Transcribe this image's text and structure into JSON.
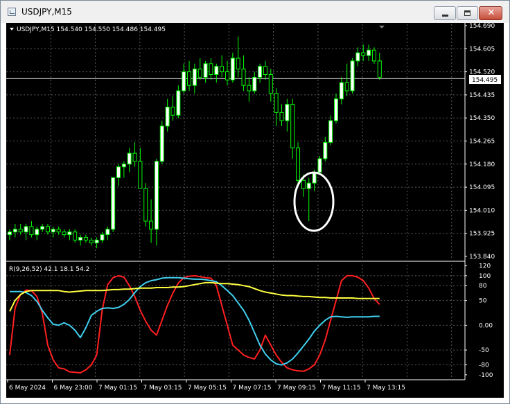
{
  "window": {
    "title": "USDJPY,M15",
    "minimize_label": "",
    "maximize_label": "",
    "close_label": "✕"
  },
  "header": {
    "symbol_info": "USDJPY,M15  154.540 154.550 154.486 154.495"
  },
  "price_axis": {
    "ticks": [
      "154.690",
      "154.605",
      "154.520",
      "154.435",
      "154.350",
      "154.265",
      "154.180",
      "154.095",
      "154.010",
      "153.925",
      "153.840"
    ],
    "current_price": "154.495"
  },
  "indicator": {
    "label": "R(9,26,52) 42.1 18.1 54.2",
    "ticks": [
      "120",
      "100",
      "80",
      "50",
      "0.00",
      "-50",
      "-80",
      "-100"
    ]
  },
  "time_axis": {
    "ticks": [
      "6 May 2024",
      "6 May 23:00",
      "7 May 01:15",
      "7 May 03:15",
      "7 May 05:15",
      "7 May 07:15",
      "7 May 09:15",
      "7 May 11:15",
      "7 May 13:15"
    ]
  },
  "colors": {
    "background": "#000000",
    "grid": "#5a5a5a",
    "candle": "#00ff00",
    "candle_fill": "#ffffff",
    "fast_line": "#ff2020",
    "mid_line": "#40d0f0",
    "slow_line": "#ffff40",
    "annotation": "#ffffff"
  },
  "chart_data": [
    {
      "type": "candlestick",
      "title": "USDJPY,M15",
      "ylim": [
        153.84,
        154.69
      ],
      "candles": [
        {
          "o": 153.92,
          "h": 153.94,
          "l": 153.9,
          "c": 153.93
        },
        {
          "o": 153.93,
          "h": 153.96,
          "l": 153.91,
          "c": 153.94
        },
        {
          "o": 153.94,
          "h": 153.96,
          "l": 153.92,
          "c": 153.93
        },
        {
          "o": 153.93,
          "h": 153.96,
          "l": 153.9,
          "c": 153.95
        },
        {
          "o": 153.95,
          "h": 153.97,
          "l": 153.91,
          "c": 153.92
        },
        {
          "o": 153.92,
          "h": 153.95,
          "l": 153.9,
          "c": 153.94
        },
        {
          "o": 153.94,
          "h": 153.96,
          "l": 153.93,
          "c": 153.95
        },
        {
          "o": 153.95,
          "h": 153.96,
          "l": 153.92,
          "c": 153.93
        },
        {
          "o": 153.93,
          "h": 153.95,
          "l": 153.91,
          "c": 153.94
        },
        {
          "o": 153.94,
          "h": 153.95,
          "l": 153.92,
          "c": 153.93
        },
        {
          "o": 153.93,
          "h": 153.94,
          "l": 153.91,
          "c": 153.92
        },
        {
          "o": 153.92,
          "h": 153.94,
          "l": 153.9,
          "c": 153.93
        },
        {
          "o": 153.93,
          "h": 153.94,
          "l": 153.89,
          "c": 153.9
        },
        {
          "o": 153.9,
          "h": 153.92,
          "l": 153.88,
          "c": 153.91
        },
        {
          "o": 153.91,
          "h": 153.92,
          "l": 153.89,
          "c": 153.9
        },
        {
          "o": 153.9,
          "h": 153.91,
          "l": 153.88,
          "c": 153.89
        },
        {
          "o": 153.89,
          "h": 153.91,
          "l": 153.87,
          "c": 153.9
        },
        {
          "o": 153.9,
          "h": 153.93,
          "l": 153.89,
          "c": 153.92
        },
        {
          "o": 153.92,
          "h": 153.95,
          "l": 153.9,
          "c": 153.94
        },
        {
          "o": 153.94,
          "h": 154.1,
          "l": 153.93,
          "c": 154.13
        },
        {
          "o": 154.13,
          "h": 154.18,
          "l": 154.1,
          "c": 154.17
        },
        {
          "o": 154.17,
          "h": 154.19,
          "l": 154.13,
          "c": 154.18
        },
        {
          "o": 154.18,
          "h": 154.24,
          "l": 154.15,
          "c": 154.22
        },
        {
          "o": 154.22,
          "h": 154.26,
          "l": 154.17,
          "c": 154.19
        },
        {
          "o": 154.19,
          "h": 154.24,
          "l": 154.09,
          "c": 154.09
        },
        {
          "o": 154.09,
          "h": 154.11,
          "l": 153.95,
          "c": 153.97
        },
        {
          "o": 153.97,
          "h": 154.05,
          "l": 153.89,
          "c": 153.94
        },
        {
          "o": 153.94,
          "h": 154.2,
          "l": 153.88,
          "c": 154.19
        },
        {
          "o": 154.19,
          "h": 154.34,
          "l": 154.18,
          "c": 154.32
        },
        {
          "o": 154.32,
          "h": 154.42,
          "l": 154.3,
          "c": 154.39
        },
        {
          "o": 154.39,
          "h": 154.43,
          "l": 154.34,
          "c": 154.36
        },
        {
          "o": 154.36,
          "h": 154.47,
          "l": 154.35,
          "c": 154.45
        },
        {
          "o": 154.45,
          "h": 154.55,
          "l": 154.44,
          "c": 154.52
        },
        {
          "o": 154.52,
          "h": 154.56,
          "l": 154.45,
          "c": 154.47
        },
        {
          "o": 154.47,
          "h": 154.55,
          "l": 154.44,
          "c": 154.53
        },
        {
          "o": 154.53,
          "h": 154.57,
          "l": 154.49,
          "c": 154.5
        },
        {
          "o": 154.5,
          "h": 154.56,
          "l": 154.48,
          "c": 154.55
        },
        {
          "o": 154.55,
          "h": 154.57,
          "l": 154.49,
          "c": 154.51
        },
        {
          "o": 154.51,
          "h": 154.55,
          "l": 154.48,
          "c": 154.54
        },
        {
          "o": 154.54,
          "h": 154.58,
          "l": 154.5,
          "c": 154.52
        },
        {
          "o": 154.52,
          "h": 154.56,
          "l": 154.47,
          "c": 154.49
        },
        {
          "o": 154.49,
          "h": 154.59,
          "l": 154.48,
          "c": 154.57
        },
        {
          "o": 154.57,
          "h": 154.65,
          "l": 154.5,
          "c": 154.53
        },
        {
          "o": 154.53,
          "h": 154.58,
          "l": 154.45,
          "c": 154.47
        },
        {
          "o": 154.47,
          "h": 154.5,
          "l": 154.41,
          "c": 154.45
        },
        {
          "o": 154.45,
          "h": 154.52,
          "l": 154.44,
          "c": 154.5
        },
        {
          "o": 154.5,
          "h": 154.55,
          "l": 154.48,
          "c": 154.54
        },
        {
          "o": 154.54,
          "h": 154.56,
          "l": 154.49,
          "c": 154.51
        },
        {
          "o": 154.51,
          "h": 154.53,
          "l": 154.41,
          "c": 154.44
        },
        {
          "o": 154.44,
          "h": 154.46,
          "l": 154.32,
          "c": 154.37
        },
        {
          "o": 154.37,
          "h": 154.4,
          "l": 154.32,
          "c": 154.34
        },
        {
          "o": 154.34,
          "h": 154.42,
          "l": 154.3,
          "c": 154.4
        },
        {
          "o": 154.4,
          "h": 154.42,
          "l": 154.2,
          "c": 154.24
        },
        {
          "o": 154.24,
          "h": 154.26,
          "l": 154.1,
          "c": 154.12
        },
        {
          "o": 154.12,
          "h": 154.14,
          "l": 154.06,
          "c": 154.09
        },
        {
          "o": 154.09,
          "h": 154.13,
          "l": 153.97,
          "c": 154.11
        },
        {
          "o": 154.11,
          "h": 154.16,
          "l": 154.08,
          "c": 154.15
        },
        {
          "o": 154.15,
          "h": 154.21,
          "l": 154.14,
          "c": 154.2
        },
        {
          "o": 154.2,
          "h": 154.28,
          "l": 154.19,
          "c": 154.26
        },
        {
          "o": 154.26,
          "h": 154.36,
          "l": 154.25,
          "c": 154.34
        },
        {
          "o": 154.34,
          "h": 154.44,
          "l": 154.33,
          "c": 154.42
        },
        {
          "o": 154.42,
          "h": 154.5,
          "l": 154.4,
          "c": 154.48
        },
        {
          "o": 154.48,
          "h": 154.55,
          "l": 154.43,
          "c": 154.45
        },
        {
          "o": 154.45,
          "h": 154.57,
          "l": 154.44,
          "c": 154.56
        },
        {
          "o": 154.56,
          "h": 154.61,
          "l": 154.54,
          "c": 154.59
        },
        {
          "o": 154.59,
          "h": 154.62,
          "l": 154.56,
          "c": 154.58
        },
        {
          "o": 154.58,
          "h": 154.62,
          "l": 154.56,
          "c": 154.6
        },
        {
          "o": 154.6,
          "h": 154.61,
          "l": 154.55,
          "c": 154.56
        },
        {
          "o": 154.56,
          "h": 154.59,
          "l": 154.49,
          "c": 154.5
        }
      ]
    },
    {
      "type": "line",
      "title": "R(9,26,52) 42.1 18.1 54.2",
      "ylim": [
        -110,
        125
      ],
      "series": [
        {
          "values": [
            -60,
            35,
            62,
            71,
            70,
            58,
            24,
            -40,
            -70,
            -86,
            -88,
            -94,
            -95,
            -96,
            -90,
            -80,
            -60,
            30,
            82,
            96,
            100,
            97,
            80,
            58,
            30,
            8,
            -10,
            -20,
            10,
            40,
            65,
            85,
            96,
            99,
            100,
            98,
            96,
            95,
            80,
            40,
            0,
            -40,
            -50,
            -60,
            -65,
            -68,
            -50,
            -20,
            -40,
            -60,
            -75,
            -86,
            -90,
            -92,
            -93,
            -88,
            -80,
            -60,
            -30,
            10,
            50,
            90,
            100,
            100,
            97,
            90,
            75,
            54,
            42
          ]
        },
        {
          "values": [
            68,
            68,
            68,
            66,
            60,
            48,
            30,
            15,
            2,
            0,
            5,
            0,
            -10,
            -25,
            -5,
            20,
            28,
            34,
            35,
            34,
            36,
            42,
            52,
            66,
            78,
            86,
            90,
            92,
            95,
            96,
            96,
            96,
            95,
            94,
            93,
            93,
            92,
            90,
            88,
            80,
            70,
            60,
            45,
            30,
            10,
            -15,
            -40,
            -58,
            -70,
            -78,
            -80,
            -76,
            -68,
            -56,
            -42,
            -28,
            -12,
            0,
            10,
            17,
            18,
            17,
            16,
            17,
            17,
            17,
            17,
            18,
            18
          ]
        },
        {
          "values": [
            28,
            50,
            62,
            68,
            70,
            70,
            70,
            70,
            70,
            70,
            68,
            67,
            68,
            69,
            70,
            70,
            70,
            70,
            71,
            72,
            72,
            73,
            73,
            74,
            75,
            75,
            75,
            76,
            76,
            76,
            77,
            77,
            78,
            80,
            82,
            84,
            86,
            86,
            85,
            84,
            84,
            83,
            82,
            80,
            78,
            74,
            70,
            67,
            65,
            63,
            61,
            60,
            60,
            59,
            58,
            58,
            57,
            56,
            56,
            55,
            55,
            55,
            55,
            55,
            54,
            54,
            54,
            54,
            54
          ]
        }
      ]
    }
  ]
}
